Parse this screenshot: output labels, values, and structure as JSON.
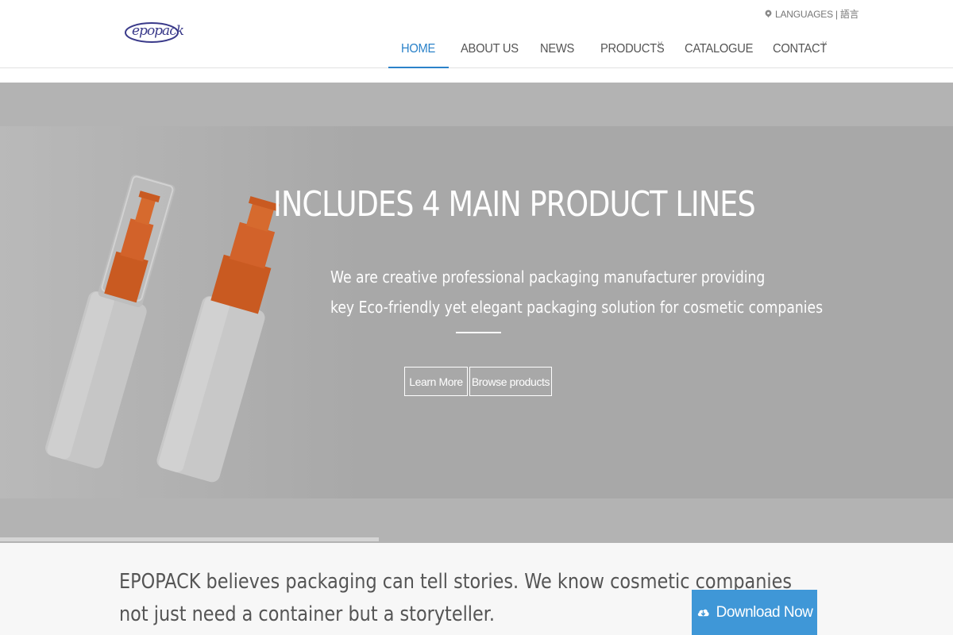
{
  "brand": {
    "logo_text": "epopack"
  },
  "languages": {
    "label": "LANGUAGES",
    "separator": "|",
    "alt": "語言"
  },
  "nav": {
    "items": [
      {
        "label": "HOME"
      },
      {
        "label": "ABOUT US"
      },
      {
        "label": "NEWS"
      },
      {
        "label": "PRODUCTS"
      },
      {
        "label": "CATALOGUE"
      },
      {
        "label": "CONTACT"
      }
    ],
    "caret": "˅"
  },
  "hero": {
    "title": "INCLUDES 4 MAIN PRODUCT LINES",
    "subtitle_line1": "We are creative professional packaging manufacturer providing",
    "subtitle_line2": "key Eco-friendly yet elegant packaging solution for cosmetic companies",
    "learn_more": "Learn More",
    "browse_products": "Browse products"
  },
  "story": {
    "line1": "EPOPACK believes packaging can tell stories. We know cosmetic companies",
    "line2": "not just need a container but a storyteller.",
    "download_label": "Download Now"
  },
  "colors": {
    "accent": "#2b82c9",
    "download": "#3f97d7",
    "pump_orange": "#e8651e",
    "hero_overlay": "#a8a8a8"
  },
  "icons": {
    "language": "globe-pin-icon",
    "download": "cloud-download-icon",
    "dropdown": "chevron-down-icon"
  }
}
